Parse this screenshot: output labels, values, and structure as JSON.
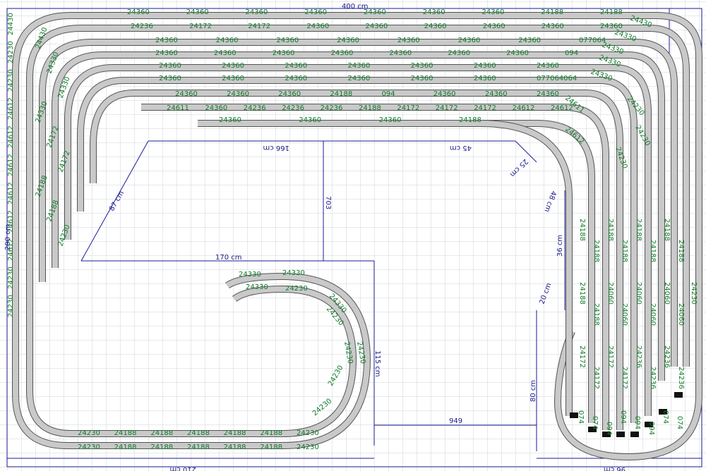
{
  "dimensions": {
    "top_width": "400 cm",
    "left_height": "290 cm",
    "inner_166": "166 cm",
    "inner_45": "45 cm",
    "inner_25": "25 cm",
    "inner_48": "48 cm",
    "inner_703": "703",
    "inner_170": "170 cm",
    "diag_87": "87 cm",
    "right_36": "36 cm",
    "right_20": "20 cm",
    "right_80": "80 cm",
    "mid_115": "115 cm",
    "bottom_949": "949",
    "bottom_210": "210 cm",
    "bottom_96": "96 cm"
  },
  "rows": [
    {
      "labels": [
        "24360",
        "24360",
        "24360",
        "24360",
        "24360",
        "24360",
        "24360",
        "24188",
        "24188"
      ]
    },
    {
      "labels": [
        "24236",
        "24172",
        "24172",
        "24360",
        "24360",
        "24360",
        "24360",
        "24360",
        "24360"
      ]
    },
    {
      "labels": [
        "24360",
        "24360",
        "24360",
        "24360",
        "24360",
        "24360",
        "24360",
        "077064"
      ]
    },
    {
      "labels": [
        "24360",
        "24360",
        "24360",
        "24360",
        "24360",
        "24360",
        "24360",
        "094"
      ]
    },
    {
      "labels": [
        "24360",
        "24360",
        "24360",
        "24360",
        "24360",
        "24360",
        "24360"
      ]
    },
    {
      "labels": [
        "24360",
        "24360",
        "24360",
        "24360",
        "24360",
        "24360",
        "077064064"
      ]
    },
    {
      "labels": [
        "24360",
        "24360",
        "24360",
        "24188",
        "094",
        "24360",
        "24360",
        "24360"
      ]
    },
    {
      "labels": [
        "24611",
        "24360",
        "24236",
        "24236",
        "24236",
        "24188",
        "24172",
        "24172",
        "24172",
        "24612",
        "24612"
      ]
    },
    {
      "labels": [
        "24360",
        "24360",
        "24360",
        "24188"
      ]
    }
  ],
  "left_labels": [
    "24430",
    "24230",
    "24230",
    "24612",
    "24612",
    "24612",
    "24612",
    "24612",
    "24612",
    "24230",
    "24230"
  ],
  "left_inner_labels": [
    "24430",
    "24330",
    "24330",
    "24330",
    "24172",
    "24172",
    "24188",
    "24188",
    "24230"
  ],
  "bottom_rows": [
    {
      "labels": [
        "24230",
        "24188",
        "24188",
        "24188",
        "24188",
        "24188",
        "24230"
      ]
    },
    {
      "labels": [
        "24230",
        "24188",
        "24188",
        "24188",
        "24188",
        "24188",
        "24230"
      ]
    }
  ],
  "loop_labels": [
    "24330",
    "24330",
    "24330",
    "24230",
    "24330",
    "24230",
    "24230",
    "24230",
    "24230",
    "24230"
  ],
  "right_labels": [
    "24430",
    "24330",
    "24330",
    "24330",
    "24330",
    "24611",
    "24230",
    "24612",
    "24230",
    "24230",
    "24230"
  ],
  "yard_labels": [
    "24188",
    "24188",
    "24188",
    "24188",
    "24188",
    "24188",
    "24188",
    "24188",
    "24188",
    "24188",
    "24060",
    "24060",
    "24060",
    "24060",
    "24060",
    "24060",
    "24172",
    "24172",
    "24172",
    "24172",
    "24236",
    "24236",
    "24236",
    "24236"
  ],
  "yard_ends": [
    "074",
    "074",
    "094",
    "094",
    "094",
    "094",
    "074",
    "074"
  ],
  "corner_labels": [
    "24430",
    "24430",
    "24330",
    "24330",
    "24330",
    "24230",
    "24230",
    "24330",
    "24230",
    "24230"
  ]
}
